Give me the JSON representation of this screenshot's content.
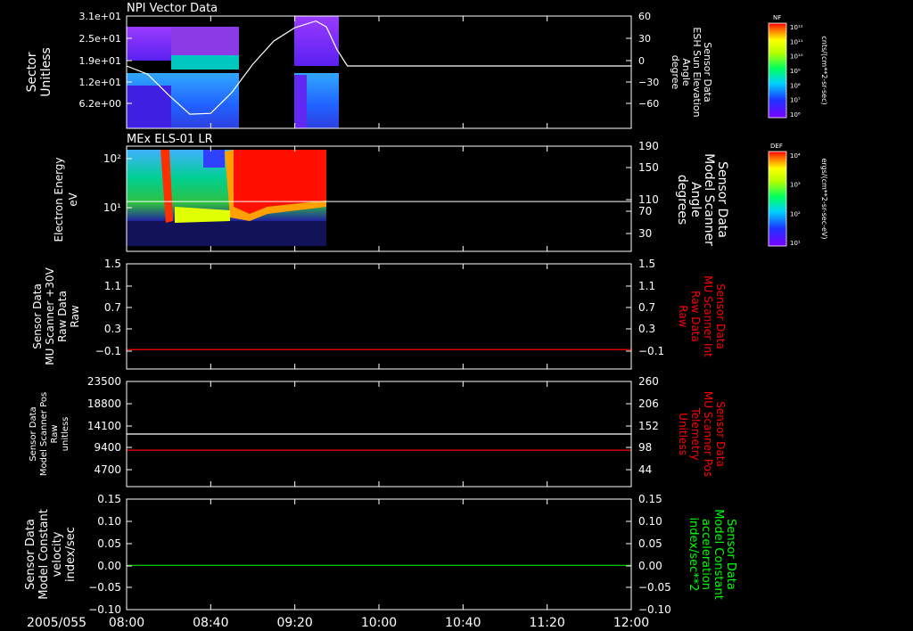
{
  "figure": {
    "date_label": "2005/055",
    "time_ticks": [
      "08:00",
      "08:40",
      "09:20",
      "10:00",
      "10:40",
      "11:20",
      "12:00"
    ]
  },
  "chart_data": [
    {
      "type": "heatmap",
      "title": "NPI Vector Data",
      "ylabel_lines": [
        "Sector",
        "Unitless"
      ],
      "y_ticks": [
        "3.1e+01",
        "2.5e+01",
        "1.9e+01",
        "1.2e+01",
        "6.2e+00"
      ],
      "right_ylabel_lines": [
        "Sensor Data",
        "ESH Sun Elevation",
        "Angle",
        "degree"
      ],
      "right_y_ticks": [
        "60",
        "30",
        "0",
        "−30",
        "−60"
      ],
      "right_ylim": [
        -75,
        60
      ],
      "xlim": [
        "08:00",
        "12:00"
      ],
      "colorbar": {
        "label": "NF",
        "units": "cnts/(cm**2-sr-sec)",
        "ticks": [
          "10¹²",
          "10¹¹",
          "10¹⁰",
          "10⁹",
          "10⁸",
          "10⁷",
          "10⁶"
        ]
      },
      "data_intervals": [
        [
          "08:00",
          "08:52"
        ],
        [
          "09:12",
          "09:36"
        ]
      ],
      "elevation_line": {
        "color": "#ffffff",
        "x": [
          "08:00",
          "08:10",
          "08:20",
          "08:30",
          "08:40",
          "08:50",
          "09:00",
          "09:10",
          "09:20",
          "09:30",
          "09:35",
          "09:40",
          "09:45",
          "10:00",
          "12:00"
        ],
        "y": [
          0,
          -10,
          -35,
          -58,
          -57,
          -32,
          2,
          30,
          46,
          54,
          47,
          20,
          0,
          0,
          0
        ]
      }
    },
    {
      "type": "heatmap",
      "title": "MEx ELS-01 LR",
      "ylabel_lines": [
        "Electron Energy",
        "eV"
      ],
      "y_ticks": [
        "10²",
        "10¹"
      ],
      "right_ylabel_lines": [
        "Sensor Data",
        "Model Scanner",
        "Angle",
        "degrees"
      ],
      "right_y_ticks": [
        "190",
        "150",
        "110",
        "70",
        "30"
      ],
      "right_ylim": [
        0,
        190
      ],
      "colorbar": {
        "label": "DEF",
        "units": "ergs/(cm**2-sr-sec-eV)",
        "ticks": [
          "10⁴",
          "10³",
          "10²",
          "10¹"
        ]
      },
      "data_intervals": [
        [
          "08:00",
          "09:36"
        ]
      ],
      "angle_line": {
        "color": "#ffffff",
        "value": 90
      }
    },
    {
      "type": "line",
      "ylabel_lines": [
        "Sensor Data",
        "MU Scanner +30V",
        "Raw Data",
        "Raw"
      ],
      "y_ticks": [
        "1.5",
        "1.1",
        "0.7",
        "0.3",
        "−0.1"
      ],
      "right_ylabel_lines": [
        "Sensor Data",
        "MU Scanner Int",
        "Raw Data",
        "Raw"
      ],
      "right_y_ticks": [
        "1.5",
        "1.1",
        "0.7",
        "0.3",
        "−0.1"
      ],
      "ylim": [
        -0.4,
        1.5
      ],
      "series": [
        {
          "color": "#ff0000",
          "x": [
            "08:00",
            "12:00"
          ],
          "y": [
            -0.05,
            -0.05
          ]
        }
      ]
    },
    {
      "type": "line",
      "ylabel_lines": [
        "Sensor Data",
        "Model Scanner Pos",
        "Raw",
        "unitless"
      ],
      "y_ticks": [
        "23500",
        "18800",
        "14100",
        "9400",
        "4700"
      ],
      "right_ylabel_lines": [
        "Sensor Data",
        "MU Scanner Pos",
        "Telemetry",
        "Unitless"
      ],
      "right_y_ticks": [
        "260",
        "206",
        "152",
        "98",
        "44"
      ],
      "ylim": [
        0,
        23500
      ],
      "right_ylim": [
        0,
        260
      ],
      "series": [
        {
          "color": "#ffffff",
          "axis": "left",
          "x": [
            "08:00",
            "12:00"
          ],
          "y": [
            11750,
            11750
          ]
        },
        {
          "color": "#ff0000",
          "axis": "right",
          "x": [
            "08:00",
            "12:00"
          ],
          "y": [
            90,
            90
          ]
        }
      ]
    },
    {
      "type": "line",
      "ylabel_lines": [
        "Sensor Data",
        "Model Constant",
        "velocity",
        "index/sec"
      ],
      "y_ticks": [
        "0.15",
        "0.10",
        "0.05",
        "0.00",
        "−0.05",
        "−0.10"
      ],
      "right_ylabel_lines": [
        "Sensor Data",
        "Model Constant",
        "acceleration",
        "index/sec**2"
      ],
      "right_y_ticks": [
        "0.15",
        "0.10",
        "0.05",
        "0.00",
        "−0.05",
        "−0.10"
      ],
      "ylim": [
        -0.1,
        0.15
      ],
      "series": [
        {
          "color": "#00cc00",
          "x": [
            "08:00",
            "12:00"
          ],
          "y": [
            0,
            0
          ]
        }
      ]
    }
  ],
  "colors": {
    "axis": "#ffffff",
    "red_label": "#ff0000",
    "green_label": "#00ff00"
  }
}
